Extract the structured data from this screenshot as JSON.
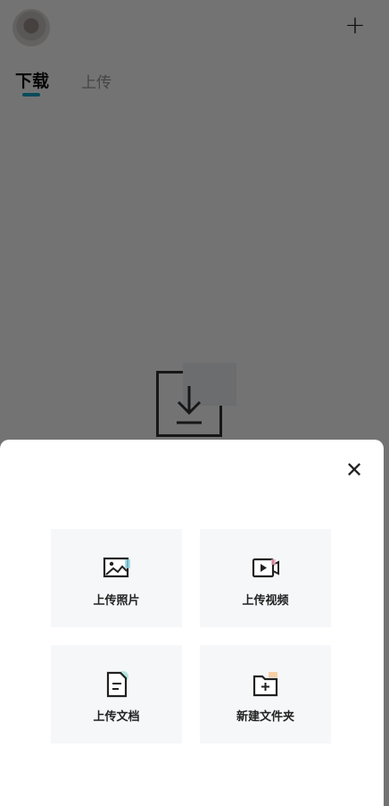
{
  "header": {
    "add_icon": "plus-icon"
  },
  "tabs": [
    {
      "label": "下载",
      "active": true
    },
    {
      "label": "上传",
      "active": false
    }
  ],
  "colors": {
    "accent": "#17a6c7",
    "overlay": "rgba(0,0,0,0.55)",
    "tile_bg": "#f6f7f8"
  },
  "upload_sheet": {
    "close_icon": "close-icon",
    "actions": [
      {
        "label": "上传照片",
        "icon": "image-icon"
      },
      {
        "label": "上传视频",
        "icon": "video-icon"
      },
      {
        "label": "上传文档",
        "icon": "document-icon"
      },
      {
        "label": "新建文件夹",
        "icon": "new-folder-icon"
      }
    ]
  }
}
